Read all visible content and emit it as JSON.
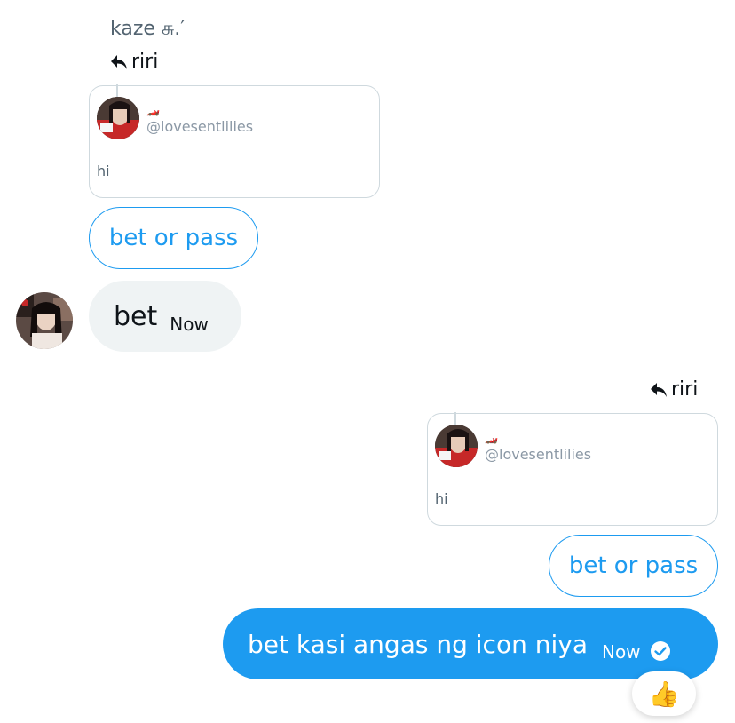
{
  "thread": {
    "sender_name": "kaze சு.′",
    "first": {
      "reply_to": "riri",
      "quote": {
        "emoji": "🏎️",
        "handle": "@lovesentlilies",
        "text": "hi"
      },
      "bubble": "bet or pass"
    },
    "reply": {
      "text": "bet",
      "time": "Now"
    },
    "second": {
      "reply_to": "riri",
      "quote": {
        "emoji": "🏎️",
        "handle": "@lovesentlilies",
        "text": "hi"
      },
      "bubble": "bet or pass"
    },
    "own_message": {
      "text": "bet kasi angas ng icon niya",
      "time": "Now",
      "status": "seen-check-icon"
    },
    "reaction": "👍"
  },
  "colors": {
    "accent": "#1d9bf0",
    "bubble_grey": "#eff3f4",
    "muted": "#536471",
    "border": "#cfd9de"
  }
}
